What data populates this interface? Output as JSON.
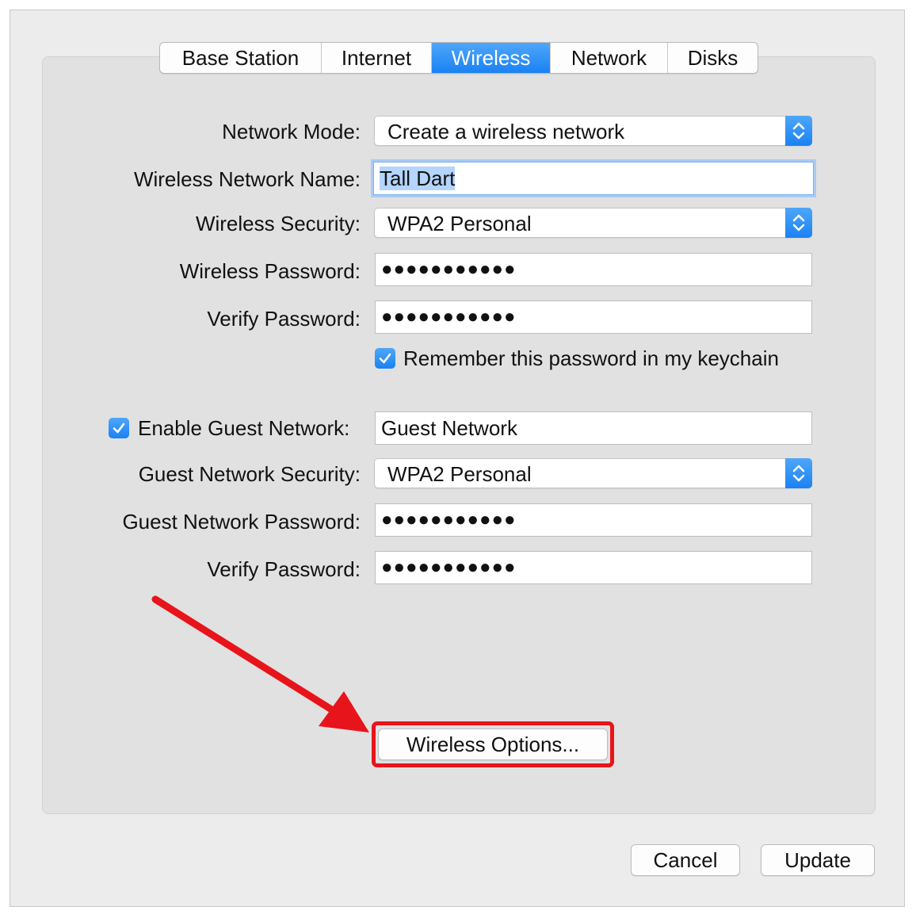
{
  "tabs": [
    {
      "label": "Base Station",
      "active": false
    },
    {
      "label": "Internet",
      "active": false
    },
    {
      "label": "Wireless",
      "active": true
    },
    {
      "label": "Network",
      "active": false
    },
    {
      "label": "Disks",
      "active": false
    }
  ],
  "form": {
    "network_mode": {
      "label": "Network Mode:",
      "value": "Create a wireless network"
    },
    "network_name": {
      "label": "Wireless Network Name:",
      "value": "Tall Dart"
    },
    "security": {
      "label": "Wireless Security:",
      "value": "WPA2 Personal"
    },
    "password": {
      "label": "Wireless Password:",
      "value": "●●●●●●●●●●●"
    },
    "verify_password": {
      "label": "Verify Password:",
      "value": "●●●●●●●●●●●"
    },
    "remember_keychain": {
      "label": "Remember this password in my keychain",
      "checked": true
    }
  },
  "guest": {
    "enable": {
      "label": "Enable Guest Network:",
      "checked": true,
      "value": "Guest Network"
    },
    "security": {
      "label": "Guest Network Security:",
      "value": "WPA2 Personal"
    },
    "password": {
      "label": "Guest Network Password:",
      "value": "●●●●●●●●●●●"
    },
    "verify_password": {
      "label": "Verify Password:",
      "value": "●●●●●●●●●●●"
    }
  },
  "buttons": {
    "wireless_options": "Wireless Options...",
    "cancel": "Cancel",
    "update": "Update"
  },
  "colors": {
    "accent": "#1a82f4",
    "annotation": "#e8141b"
  },
  "icons": {
    "stepper": "up-down-chevrons-icon",
    "checkbox": "checkmark-icon",
    "annotation": "red-arrow-icon"
  }
}
